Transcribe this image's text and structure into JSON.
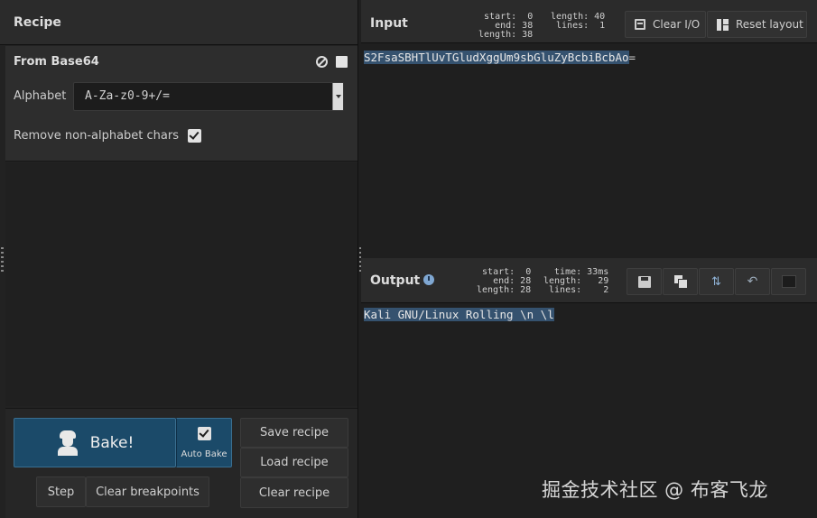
{
  "recipe": {
    "title": "Recipe",
    "operation": {
      "name": "From Base64",
      "alphabet_label": "Alphabet",
      "alphabet_value": "A-Za-z0-9+/=",
      "remove_label": "Remove non-alphabet chars",
      "remove_checked": true
    },
    "bake_label": "Bake!",
    "autobake_label": "Auto Bake",
    "step_label": "Step",
    "clear_breakpoints_label": "Clear breakpoints",
    "save_label": "Save recipe",
    "load_label": "Load recipe",
    "clear_label": "Clear recipe"
  },
  "input": {
    "title": "Input",
    "stats_left": "start:  0\n  end: 38\nlength: 38",
    "stats_right": "length: 40\n lines:  1",
    "clear_label": "Clear I/O",
    "reset_label": "Reset layout",
    "selected_text": "S2FsaSBHTlUvTGludXggUm9sbGluZyBcbiBcbAo",
    "unselected_text": "="
  },
  "output": {
    "title": "Output",
    "stats_left": "start:  0\n  end: 28\nlength: 28",
    "stats_right": " time: 33ms\nlength:   29\n lines:    2",
    "text": "Kali GNU/Linux Rolling \\n \\l"
  },
  "watermark": "掘金技术社区 @ 布客飞龙",
  "colors": {
    "bake_blue": "#1b4a69",
    "selection": "#35526f"
  }
}
